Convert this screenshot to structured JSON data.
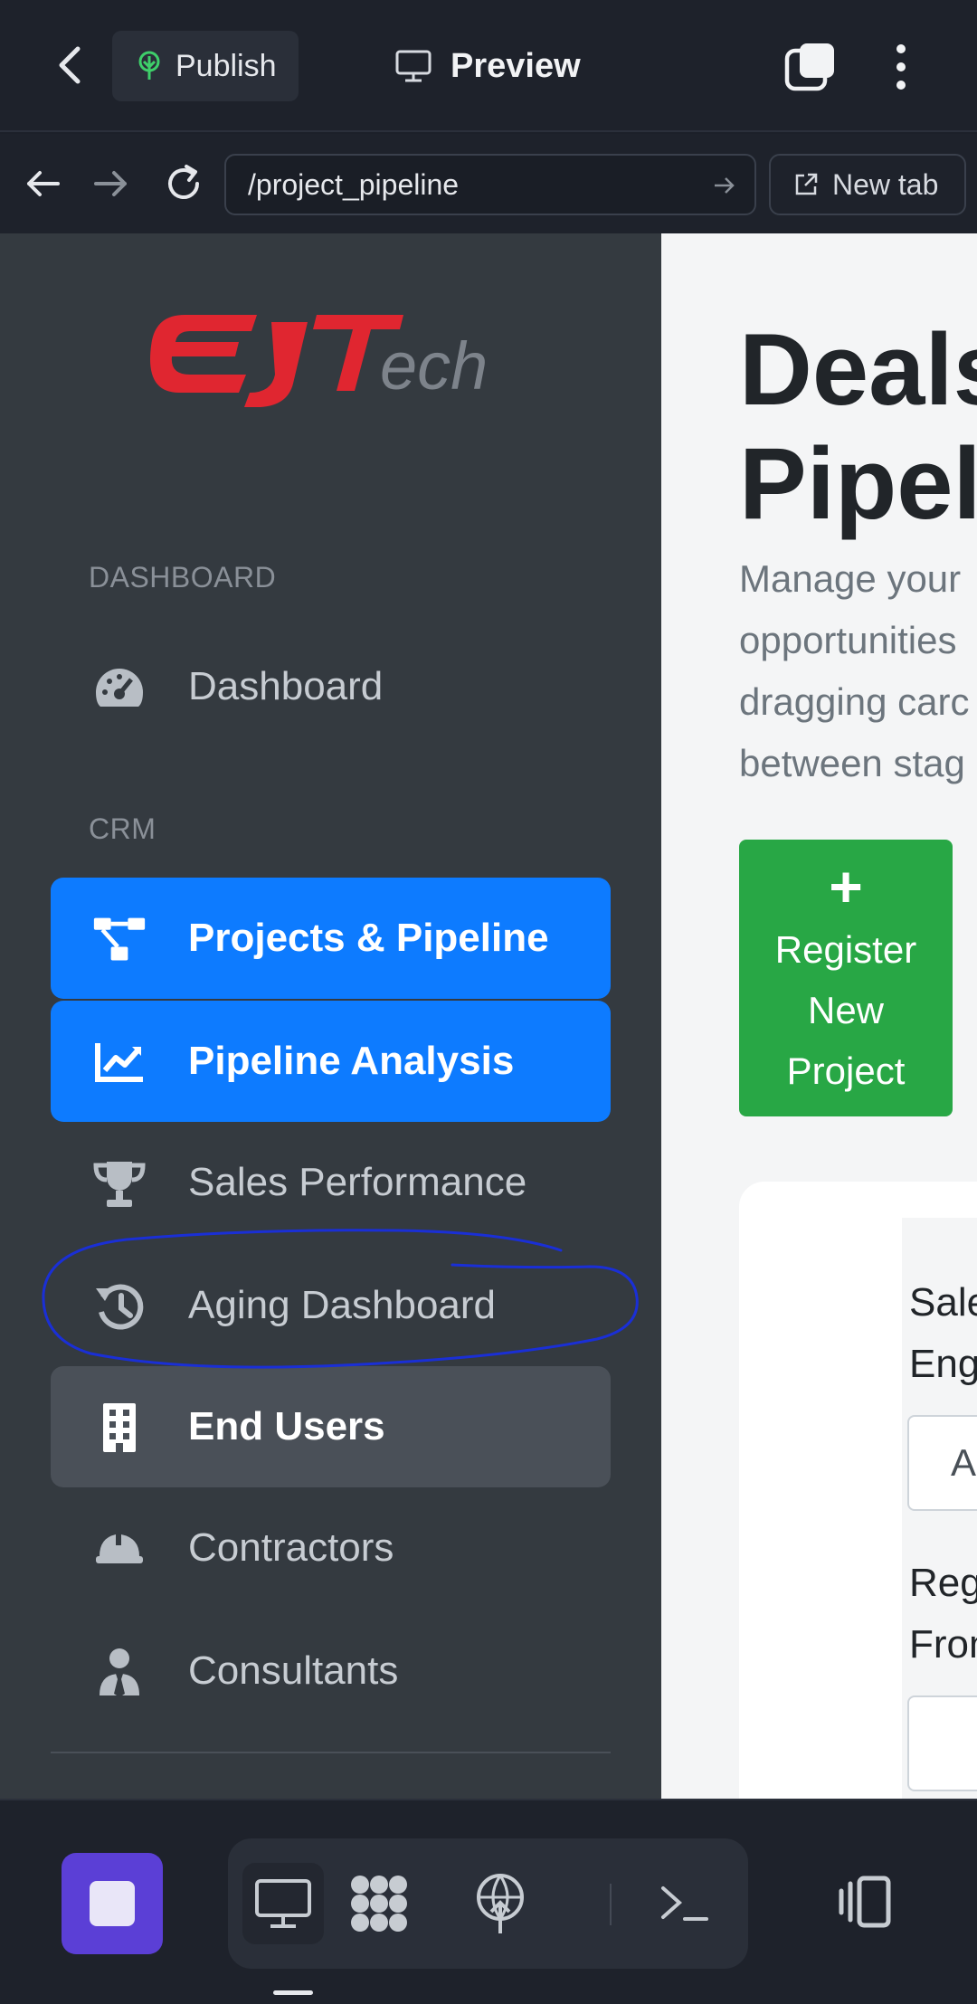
{
  "topbar": {
    "publish_label": "Publish",
    "preview_label": "Preview"
  },
  "addressbar": {
    "url": "/project_pipeline",
    "new_tab_label": "New tab"
  },
  "sidebar": {
    "logo_text": "EJTech",
    "sections": {
      "dashboard": "DASHBOARD",
      "crm": "CRM"
    },
    "items": [
      {
        "label": "Dashboard",
        "icon": "gauge-icon"
      },
      {
        "label": "Projects & Pipeline",
        "icon": "sitemap-icon",
        "state": "active"
      },
      {
        "label": "Pipeline Analysis",
        "icon": "chart-line-icon",
        "state": "active",
        "annotated": true
      },
      {
        "label": "Sales Performance",
        "icon": "trophy-icon"
      },
      {
        "label": "Aging Dashboard",
        "icon": "history-icon"
      },
      {
        "label": "End Users",
        "icon": "building-icon",
        "state": "hover"
      },
      {
        "label": "Contractors",
        "icon": "hard-hat-icon"
      },
      {
        "label": "Consultants",
        "icon": "user-tie-icon"
      }
    ]
  },
  "main": {
    "title_line1": "Deals",
    "title_line2": "Pipeli",
    "subtitle_lines": [
      "Manage your",
      "opportunities",
      "dragging carc",
      "between stag"
    ],
    "register_button": {
      "plus": "+",
      "line1": "Register",
      "line2": "New",
      "line3": "Project"
    },
    "filters": {
      "sales_engineer_label_1": "Sales",
      "sales_engineer_label_2": "Engineer",
      "sales_engineer_value": "All",
      "register_from_label_1": "Register",
      "register_from_label_2": "From"
    }
  },
  "colors": {
    "sidebar_bg": "#343a40",
    "active_blue": "#0d7bff",
    "success_green": "#28a745",
    "logo_red": "#e02630",
    "annotation_blue": "#1a2fd6",
    "dock_accent": "#5b3fd6"
  }
}
